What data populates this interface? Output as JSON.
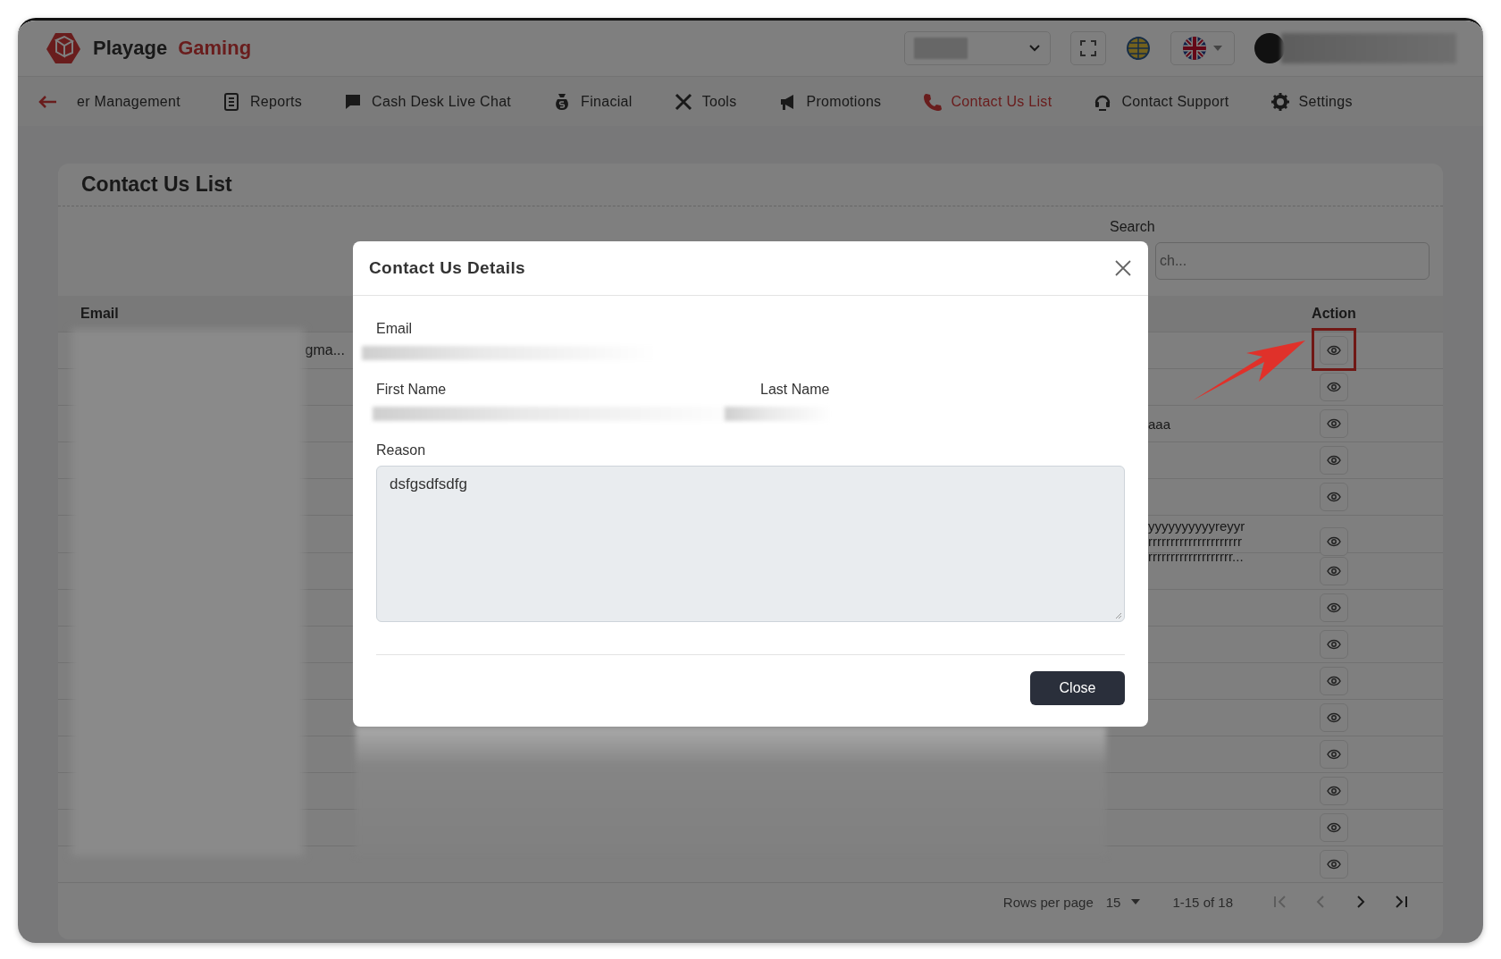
{
  "header": {
    "brand": {
      "name": "Playage",
      "accent": "Gaming"
    }
  },
  "nav": {
    "items": [
      {
        "label": "er Management",
        "selected": false
      },
      {
        "label": "Reports",
        "selected": false
      },
      {
        "label": "Cash Desk Live Chat",
        "selected": false
      },
      {
        "label": "Finacial",
        "selected": false
      },
      {
        "label": "Tools",
        "selected": false
      },
      {
        "label": "Promotions",
        "selected": false
      },
      {
        "label": "Contact Us List",
        "selected": true
      },
      {
        "label": "Contact Support",
        "selected": false
      },
      {
        "label": "Settings",
        "selected": false
      }
    ]
  },
  "page": {
    "title": "Contact Us List",
    "search": {
      "label": "Search",
      "placeholder": "ch..."
    }
  },
  "table": {
    "columns": [
      "Email",
      "Action"
    ],
    "rows": [
      {
        "email": "gma...",
        "annotated": true
      },
      {
        "annotated": false
      },
      {
        "column_4": "aaa",
        "annotated": false
      },
      {
        "annotated": false
      },
      {
        "annotated": false
      },
      {
        "column_4": "yyyyyyyyyyreyyr\nrrrrrrrrrrrrrrrrrrrrr\nrrrrrrrrrrrrrrrrrrr...",
        "annotated": false
      },
      {
        "annotated": false
      },
      {
        "annotated": false
      },
      {
        "annotated": false
      },
      {
        "annotated": false
      },
      {
        "annotated": false
      },
      {
        "annotated": false
      },
      {
        "annotated": false
      },
      {
        "annotated": false
      },
      {
        "annotated": false
      }
    ]
  },
  "pagination": {
    "rows_per_page_label": "Rows per page",
    "rows_per_page": "15",
    "range": "1-15 of 18",
    "buttons": [
      {
        "kind": "first",
        "disabled": true
      },
      {
        "kind": "prev",
        "disabled": true
      },
      {
        "kind": "next",
        "disabled": false
      },
      {
        "kind": "last",
        "disabled": false
      }
    ]
  },
  "modal": {
    "title": "Contact Us Details",
    "email_label": "Email",
    "first_name_label": "First Name",
    "last_name_label": "Last Name",
    "reason_label": "Reason",
    "reason_value": "dsfgsdfsdfg",
    "close_button": "Close"
  }
}
